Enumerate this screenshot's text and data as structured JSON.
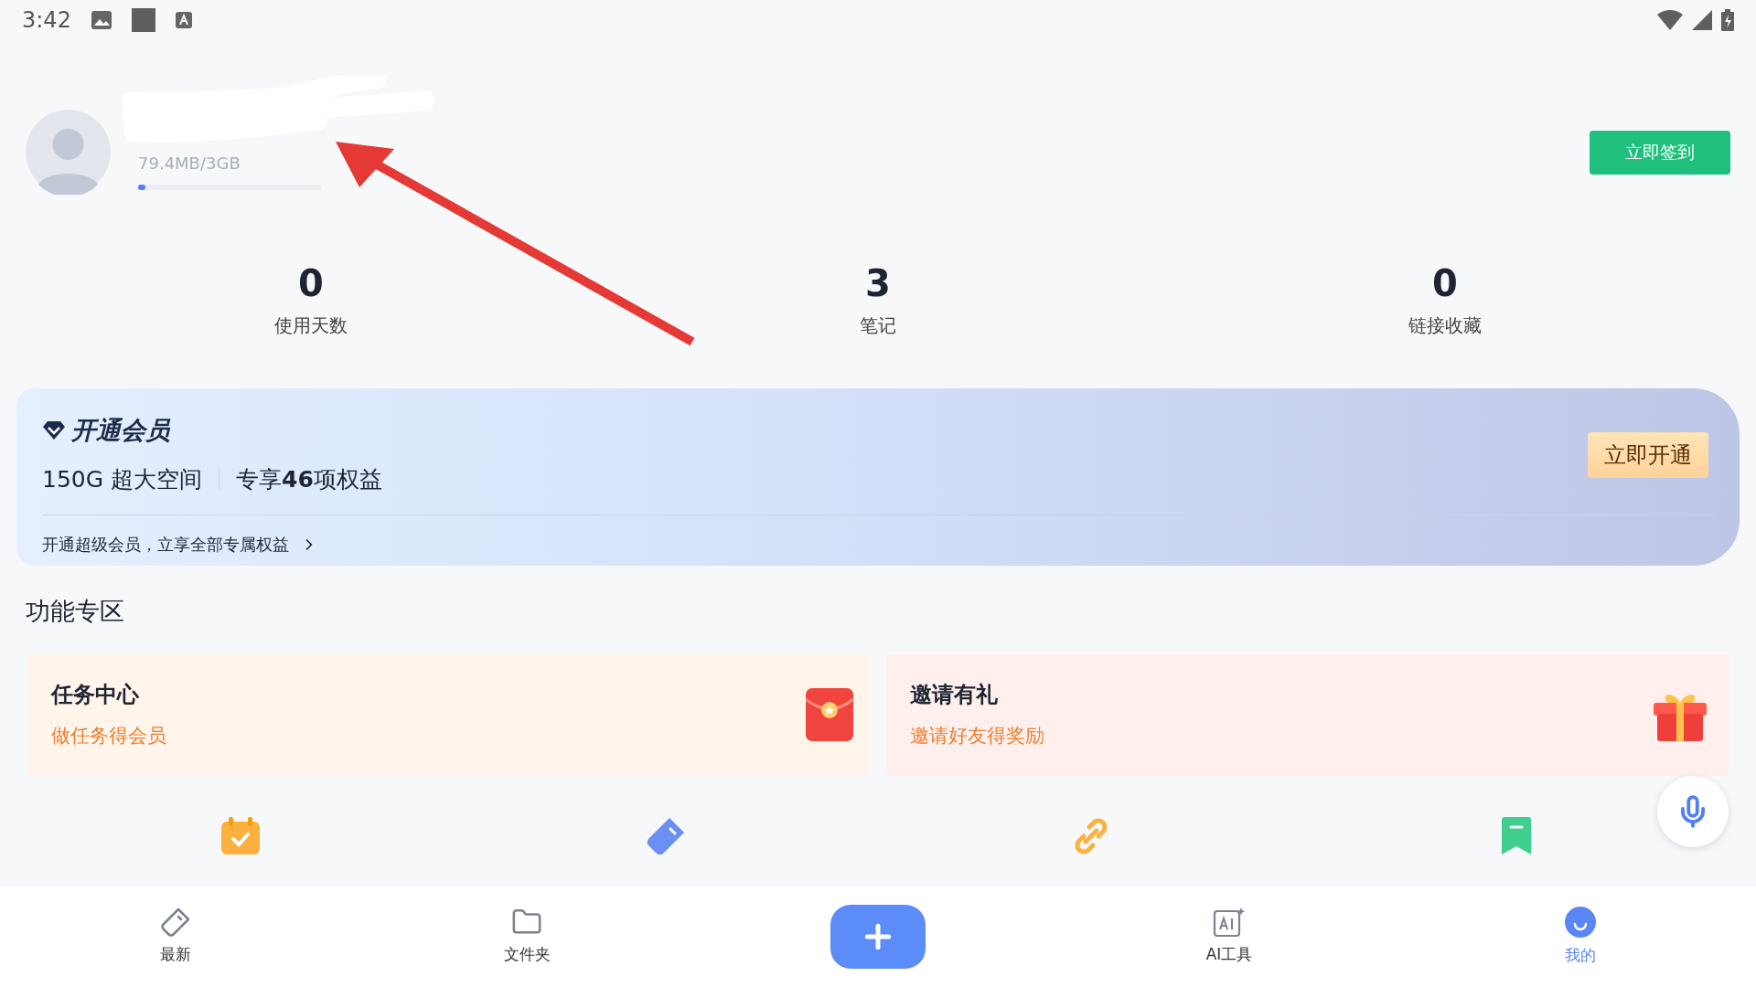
{
  "status_bar": {
    "time": "3:42"
  },
  "profile": {
    "storage": "79.4MB/3GB",
    "storage_bar": {
      "level": 0.03
    },
    "sign_in_button": "立即签到"
  },
  "stats": [
    {
      "value": "0",
      "label": "使用天数"
    },
    {
      "value": "3",
      "label": "笔记"
    },
    {
      "value": "0",
      "label": "链接收藏"
    }
  ],
  "membership": {
    "title": "开通会员",
    "benefits": [
      "150G 超大空间",
      "专享**46**项权益"
    ],
    "button": "立即开通",
    "link": "开通超级会员，立享全部专属权益"
  },
  "section_title": "功能专区",
  "feature_cards": [
    {
      "title": "任务中心",
      "subtitle": "做任务得会员",
      "kind": "task"
    },
    {
      "title": "邀请有礼",
      "subtitle": "邀请好友得奖励",
      "kind": "invite"
    }
  ],
  "shortcuts": [
    {
      "kind": "calendar"
    },
    {
      "kind": "tag"
    },
    {
      "kind": "link"
    },
    {
      "kind": "bookmark"
    }
  ],
  "bottom_nav": [
    {
      "kind": "latest",
      "label": "最新",
      "selected": false
    },
    {
      "kind": "folder",
      "label": "文件夹",
      "selected": false
    },
    {
      "kind": "add",
      "selected": false
    },
    {
      "kind": "ai",
      "label": "AI工具",
      "selected": false
    },
    {
      "kind": "me",
      "label": "我的",
      "selected": true
    }
  ]
}
